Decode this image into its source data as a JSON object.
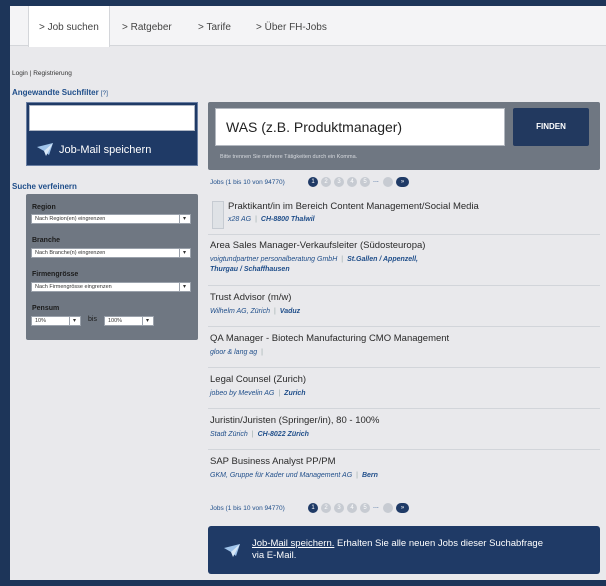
{
  "nav": {
    "tabs": [
      "> Job suchen",
      "> Ratgeber",
      "> Tarife",
      "> Über FH-Jobs"
    ]
  },
  "account": {
    "login": "Login",
    "sep": " | ",
    "register": "Registrierung"
  },
  "filters": {
    "title": "Angewandte Suchfilter",
    "help": "[?]"
  },
  "jobmail": {
    "label": "Job-Mail speichern"
  },
  "refine": {
    "title": "Suche verfeinern",
    "region_label": "Region",
    "region_value": "Nach Region(en) eingrenzen",
    "branche_label": "Branche",
    "branche_value": "Nach Branche(n) eingrenzen",
    "size_label": "Firmengrösse",
    "size_value": "Nach Firmengrösse eingrenzen",
    "pensum_label": "Pensum",
    "pensum_from": "10%",
    "pensum_bis": "bis",
    "pensum_to": "100%"
  },
  "search": {
    "placeholder": "WAS (z.B. Produktmanager)",
    "button": "FINDEN",
    "hint": "Bitte trennen Sie mehrere Tätigkeiten durch ein Komma."
  },
  "pager": {
    "label": "Jobs (1 bis 10 von 94770)",
    "pages": [
      "1",
      "2",
      "3",
      "4",
      "5"
    ],
    "dots": "...",
    "next": "»"
  },
  "jobs": [
    {
      "title": "Praktikant/in im Bereich Content Management/Social Media",
      "company": "x28 AG",
      "location": "CH-8800 Thalwil",
      "location2": ""
    },
    {
      "title": "Area Sales Manager-Verkaufsleiter (Südosteuropa)",
      "company": "voigtundpartner personalberatung GmbH",
      "location": "St.Gallen / Appenzell,",
      "location2": "Thurgau / Schaffhausen"
    },
    {
      "title": "Trust Advisor (m/w)",
      "company": "Wilhelm AG, Zürich",
      "location": "Vaduz",
      "location2": ""
    },
    {
      "title": "QA Manager - Biotech Manufacturing CMO Management",
      "company": "gloor & lang ag",
      "location": "",
      "location2": ""
    },
    {
      "title": "Legal Counsel (Zurich)",
      "company": "jobeo by Mevelin AG",
      "location": "Zurich",
      "location2": ""
    },
    {
      "title": "Juristin/Juristen (Springer/in), 80 - 100%",
      "company": "Stadt Zürich",
      "location": "CH-8022 Zürich",
      "location2": ""
    },
    {
      "title": "SAP Business Analyst PP/PM",
      "company": "GKM, Gruppe für Kader und Management AG",
      "location": "Bern",
      "location2": ""
    }
  ],
  "cta": {
    "link": "Job-Mail speichern.",
    "text": " Erhalten Sie alle neuen Jobs dieser Suchabfrage via E-Mail."
  }
}
